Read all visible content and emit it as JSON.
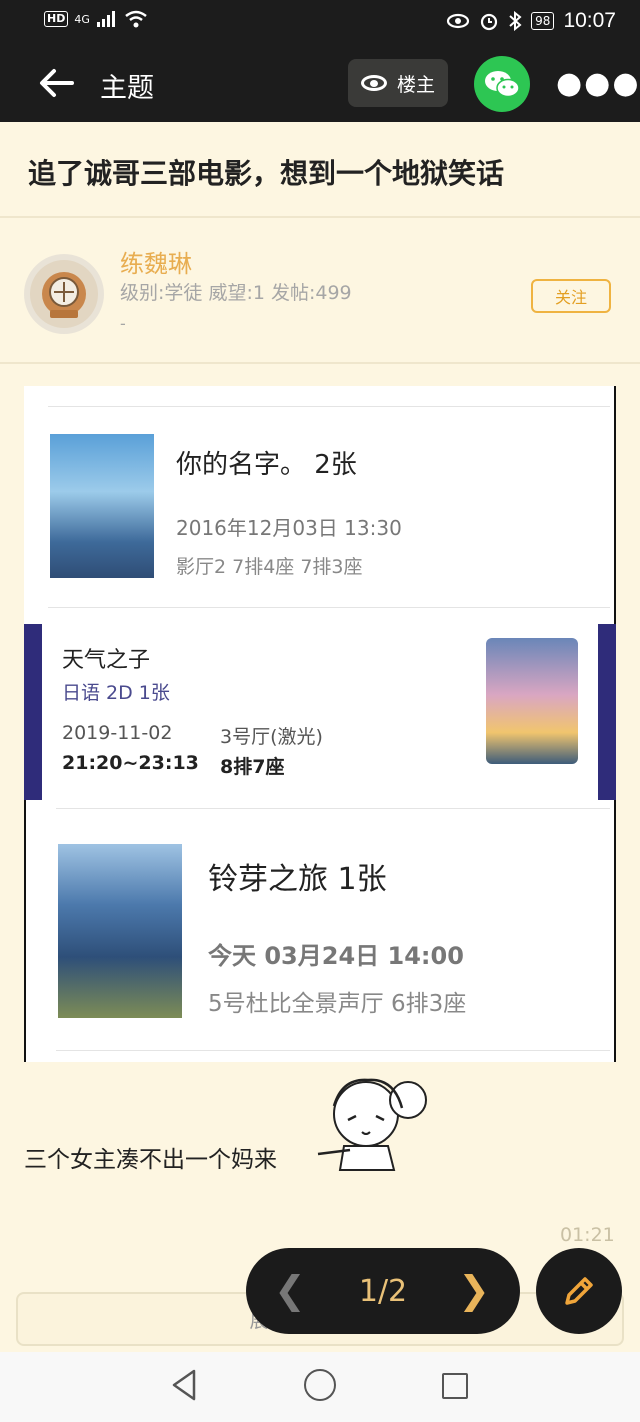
{
  "status_bar": {
    "network_badge": "HD",
    "signal_text": "4G",
    "battery": "98",
    "time": "10:07"
  },
  "top_bar": {
    "title": "主题",
    "owner_only_label": "楼主"
  },
  "thread": {
    "title": "追了诚哥三部电影，想到一个地狱笑话"
  },
  "author": {
    "name": "练魏琳",
    "meta": "级别:学徒  威望:1  发帖:499",
    "signature": "-",
    "follow_label": "关注"
  },
  "tickets": [
    {
      "movie": "你的名字。 2张",
      "datetime": "2016年12月03日 13:30",
      "seats": "影厅2 7排4座 7排3座"
    },
    {
      "movie": "天气之子",
      "format": "日语 2D 1张",
      "date": "2019-11-02",
      "time": "21:20~23:13",
      "hall": "3号厅(激光)",
      "seat": "8排7座"
    },
    {
      "movie": "铃芽之旅 1张",
      "datetime": "今天 03月24日 14:00",
      "seats": "5号杜比全景声厅 6排3座"
    }
  ],
  "post": {
    "text": "三个女主凑不出一个妈来",
    "time": "01:21"
  },
  "pager": {
    "page": "1/2"
  },
  "expand": {
    "label": "展开全部回帖(3)"
  },
  "colors": {
    "page_bg": "#fdf6e1",
    "top_bar_bg": "#1c1c1c",
    "accent": "#e8ad50",
    "wechat_green": "#2dc653",
    "ticket_band": "#2f2c7a"
  },
  "icons": [
    "back-arrow-icon",
    "eye-icon",
    "wechat-icon",
    "more-icon",
    "prev-icon",
    "next-icon",
    "pencil-icon"
  ]
}
